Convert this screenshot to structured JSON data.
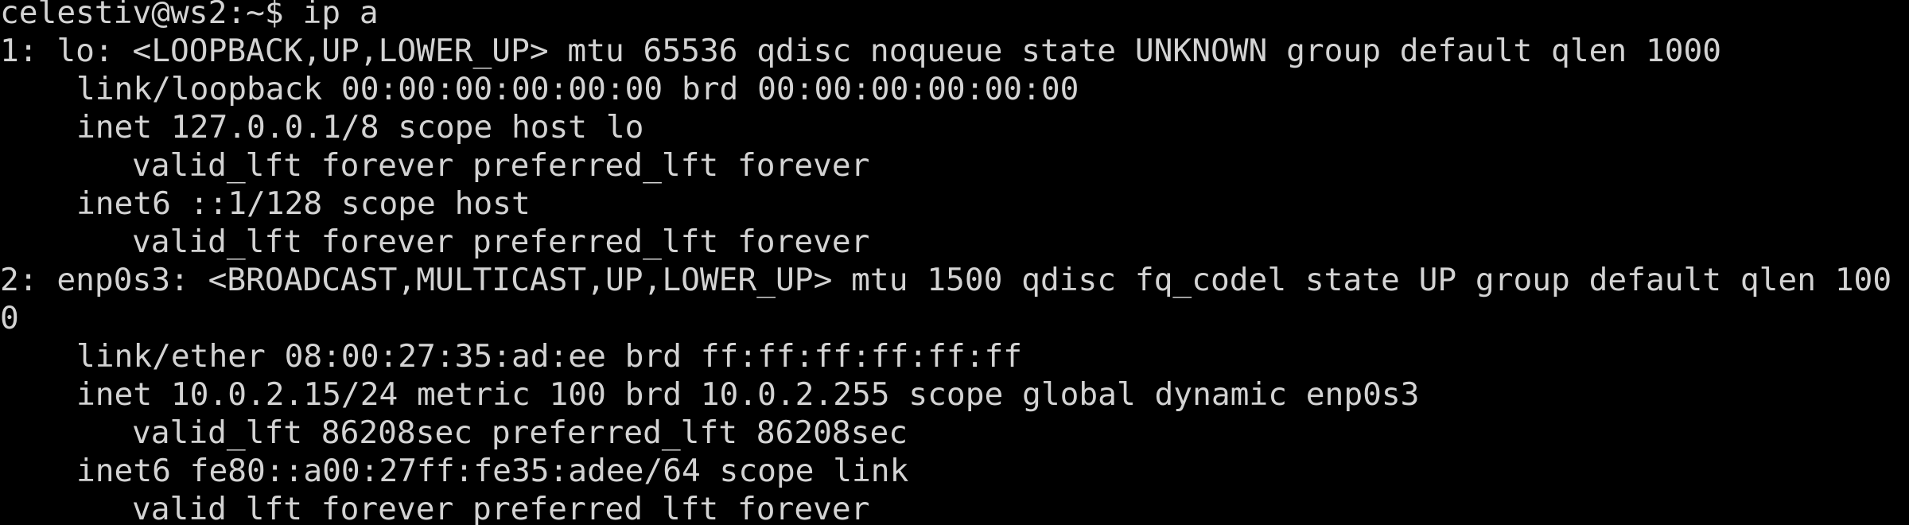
{
  "terminal": {
    "background": "#000000",
    "foreground": "#d3d3d3",
    "lines": [
      "celestiv@ws2:~$ ip a",
      "1: lo: <LOOPBACK,UP,LOWER_UP> mtu 65536 qdisc noqueue state UNKNOWN group default qlen 1000",
      "link/loopback 00:00:00:00:00:00 brd 00:00:00:00:00:00",
      "inet 127.0.0.1/8 scope host lo",
      "valid_lft forever preferred_lft forever",
      "inet6 ::1/128 scope host",
      "valid_lft forever preferred_lft forever",
      "2: enp0s3: <BROADCAST,MULTICAST,UP,LOWER_UP> mtu 1500 qdisc fq_codel state UP group default qlen 100",
      "0",
      "link/ether 08:00:27:35:ad:ee brd ff:ff:ff:ff:ff:ff",
      "inet 10.0.2.15/24 metric 100 brd 10.0.2.255 scope global dynamic enp0s3",
      "valid_lft 86208sec preferred_lft 86208sec",
      "inet6 fe80::a00:27ff:fe35:adee/64 scope link",
      "valid_lft forever preferred_lft forever"
    ]
  }
}
